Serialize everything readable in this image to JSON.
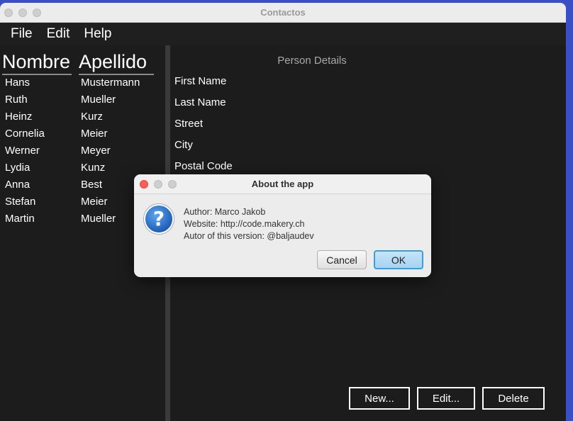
{
  "window": {
    "title": "Contactos"
  },
  "menu": {
    "items": [
      "File",
      "Edit",
      "Help"
    ]
  },
  "table": {
    "columns": [
      "Nombre",
      "Apellido"
    ],
    "rows": [
      [
        "Hans",
        "Mustermann"
      ],
      [
        "Ruth",
        "Mueller"
      ],
      [
        "Heinz",
        "Kurz"
      ],
      [
        "Cornelia",
        "Meier"
      ],
      [
        "Werner",
        "Meyer"
      ],
      [
        "Lydia",
        "Kunz"
      ],
      [
        "Anna",
        "Best"
      ],
      [
        "Stefan",
        "Meier"
      ],
      [
        "Martin",
        "Mueller"
      ]
    ]
  },
  "details": {
    "title": "Person Details",
    "labels": [
      "First Name",
      "Last Name",
      "Street",
      "City",
      "Postal Code"
    ]
  },
  "actions": {
    "new_label": "New...",
    "edit_label": "Edit...",
    "delete_label": "Delete"
  },
  "dialog": {
    "title": "About the app",
    "icon": "question-icon",
    "lines": [
      "Author: Marco Jakob",
      "Website: http://code.makery.ch",
      "Autor of this version: @baljaudev"
    ],
    "cancel_label": "Cancel",
    "ok_label": "OK"
  },
  "colors": {
    "desktop": "#3b4fc4",
    "app_background": "#1c1c1c",
    "ok_accent": "#3a9ee0"
  }
}
